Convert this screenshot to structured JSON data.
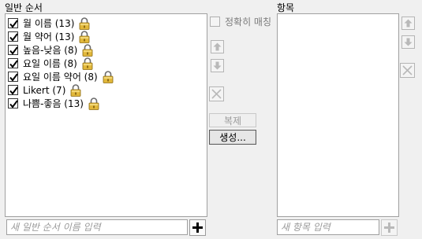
{
  "left_panel": {
    "title": "일반 순서",
    "items": [
      {
        "label": "월 이름 (13)",
        "checked": true,
        "locked": true
      },
      {
        "label": "월 약어 (13)",
        "checked": true,
        "locked": true
      },
      {
        "label": "높음-낮음 (8)",
        "checked": true,
        "locked": true
      },
      {
        "label": "요일 이름 (8)",
        "checked": true,
        "locked": true
      },
      {
        "label": "요일 이름 약어 (8)",
        "checked": true,
        "locked": true
      },
      {
        "label": "Likert (7)",
        "checked": true,
        "locked": true
      },
      {
        "label": "나쁨-좋음 (13)",
        "checked": true,
        "locked": true
      }
    ],
    "name_input_placeholder": "새 일반 순서 이름 입력"
  },
  "middle": {
    "exact_match_label": "정확히 매칭",
    "exact_match_checked": false,
    "duplicate_label": "복제",
    "create_label": "생성..."
  },
  "right_panel": {
    "title": "항목",
    "items": [],
    "item_input_placeholder": "새 항목 입력"
  },
  "icons": {
    "move_up": "arrow-up-icon",
    "move_down": "arrow-down-icon",
    "delete": "x-icon",
    "add": "plus-icon",
    "lock": "lock-icon"
  },
  "colors": {
    "disabled_icon": "#b9b9b9",
    "lock_gold": "#c9a227",
    "enabled_plus": "#000000"
  }
}
